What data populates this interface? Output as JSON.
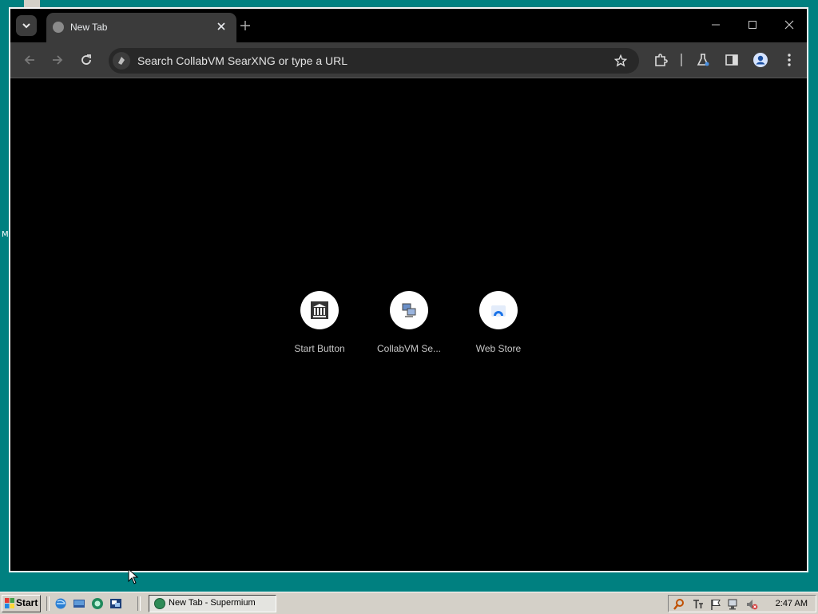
{
  "window": {
    "tab": {
      "title": "New Tab"
    },
    "omnibox": {
      "placeholder": "Search CollabVM SearXNG or type a URL"
    },
    "shortcuts": [
      {
        "label": "Start Button",
        "icon": "museum-icon"
      },
      {
        "label": "CollabVM Se...",
        "icon": "network-computers-icon"
      },
      {
        "label": "Web Store",
        "icon": "web-store-icon"
      }
    ]
  },
  "desktop": {
    "side_letter": "M"
  },
  "taskbar": {
    "start_label": "Start",
    "task_button": {
      "label": "New Tab - Supermium"
    },
    "clock": "2:47 AM"
  },
  "colors": {
    "desktop": "#008080",
    "toolbar": "#3b3b3b",
    "page": "#000000",
    "taskbar": "#d4d0c8"
  }
}
